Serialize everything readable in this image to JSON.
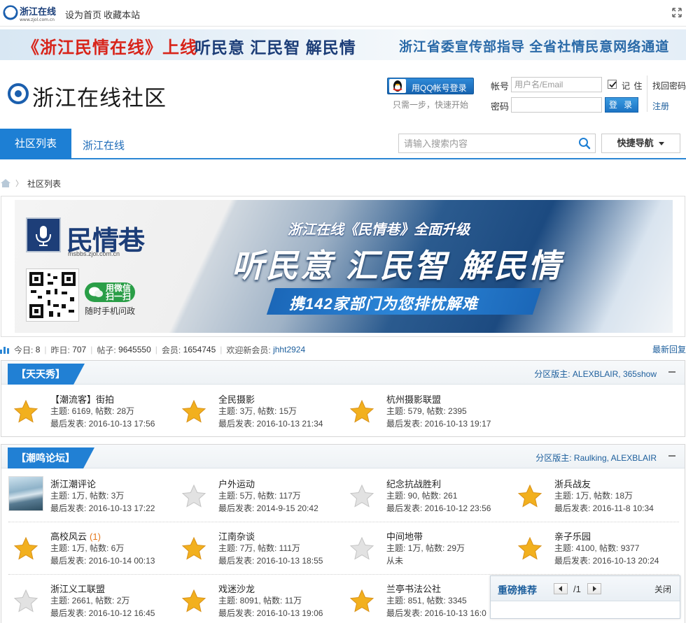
{
  "topbar": {
    "logo_text": "浙江在线",
    "logo_url": "www.zjol.com.cn",
    "set_home": "设为首页",
    "bookmark": "收藏本站"
  },
  "banner": {
    "part1": "《浙江民情在线》上线",
    "part2": "听民意 汇民智 解民情",
    "part3": "浙江省委宣传部指导 全省社情民意网络通道"
  },
  "header": {
    "site_name": "浙江在线社区",
    "qq_login": "用QQ帐号登录",
    "qq_hint": "只需一步，快速开始",
    "account_label": "帐号",
    "account_placeholder": "用户名/Email",
    "password_label": "密码",
    "remember_label": "记 住",
    "find_password": "找回密码",
    "login_button": "登 录",
    "register": "注册"
  },
  "nav": {
    "tabs": [
      {
        "label": "社区列表"
      },
      {
        "label": "浙江在线"
      }
    ],
    "search_placeholder": "请输入搜索内容",
    "quick_nav": "快捷导航"
  },
  "breadcrumb": {
    "current": "社区列表"
  },
  "promo": {
    "brand": "民情巷",
    "brand_url": "msbbs.zjol.com.cn",
    "wechat_line1": "用微信",
    "wechat_line2": "扫一扫",
    "wechat_sub": "随时手机问政",
    "headline1": "浙江在线《民情巷》全面升级",
    "headline2": "听民意 汇民智 解民情",
    "headline3": "携142家部门为您排忧解难"
  },
  "stats": {
    "today_label": "今日:",
    "today": "8",
    "yesterday_label": "昨日:",
    "yesterday": "707",
    "posts_label": "帖子:",
    "posts": "9645550",
    "members_label": "会员:",
    "members": "1654745",
    "welcome_label": "欢迎新会员:",
    "new_member": "jhht2924",
    "latest_reply": "最新回复"
  },
  "groups": [
    {
      "title": "【天天秀】",
      "moderators": "分区版主: ALEXBLAIR, 365show",
      "forums": [
        {
          "name": "【潮流客】街拍",
          "stats": "主题: 6169, 帖数: 28万",
          "last": "最后发表: 2016-10-13 17:56",
          "icon": "gold-star-icon"
        },
        {
          "name": "全民摄影",
          "stats": "主题: 3万, 帖数: 15万",
          "last": "最后发表: 2016-10-13 21:34",
          "icon": "gold-star-icon"
        },
        {
          "name": "杭州摄影联盟",
          "stats": "主题: 579, 帖数: 2395",
          "last": "最后发表: 2016-10-13 19:17",
          "icon": "gold-star-icon"
        }
      ]
    },
    {
      "title": "【潮鸣论坛】",
      "moderators": "分区版主: Raulking, ALEXBLAIR",
      "forums": [
        {
          "name": "浙江潮评论",
          "stats": "主题: 1万, 帖数: 3万",
          "last": "最后发表: 2016-10-13 17:22",
          "icon": "wave-thumbnail"
        },
        {
          "name": "户外运动",
          "stats": "主题: 5万, 帖数: 117万",
          "last": "最后发表: 2014-9-15 20:42",
          "icon": "gray-star-icon"
        },
        {
          "name": "纪念抗战胜利",
          "stats": "主题: 90, 帖数: 261",
          "last": "最后发表: 2016-10-12 23:56",
          "icon": "gray-star-icon"
        },
        {
          "name": "浙兵战友",
          "stats": "主题: 1万, 帖数: 18万",
          "last": "最后发表: 2016-11-8 10:34",
          "icon": "gold-star-icon"
        },
        {
          "name": "高校风云",
          "new_count": "(1)",
          "stats": "主题: 1万, 帖数: 6万",
          "last": "最后发表: 2016-10-14 00:13",
          "icon": "gold-star-icon"
        },
        {
          "name": "江南杂谈",
          "stats": "主题: 7万, 帖数: 111万",
          "last": "最后发表: 2016-10-13 18:55",
          "icon": "gold-star-icon"
        },
        {
          "name": "中间地带",
          "stats": "主题: 1万, 帖数: 29万",
          "last": "从未",
          "icon": "gray-star-icon"
        },
        {
          "name": "亲子乐园",
          "stats": "主题: 4100, 帖数: 9377",
          "last": "最后发表: 2016-10-13 20:24",
          "icon": "gold-star-icon"
        },
        {
          "name": "浙江义工联盟",
          "stats": "主题: 2661, 帖数: 2万",
          "last": "最后发表: 2016-10-12 16:45",
          "icon": "gray-star-icon"
        },
        {
          "name": "戏迷沙龙",
          "stats": "主题: 8091, 帖数: 11万",
          "last": "最后发表: 2016-10-13 19:06",
          "icon": "gold-star-icon"
        },
        {
          "name": "兰亭书法公社",
          "stats": "主题: 851, 帖数: 3345",
          "last": "最后发表: 2016-10-13 16:0",
          "icon": "gold-star-icon"
        }
      ]
    }
  ],
  "popup": {
    "title": "重磅推荐",
    "page": "/1",
    "close": "关闭"
  },
  "colors": {
    "accent": "#1d7fd4",
    "link": "#1c5e9c",
    "banner_red": "#d8241a",
    "star_gold": "#f2b01e"
  }
}
